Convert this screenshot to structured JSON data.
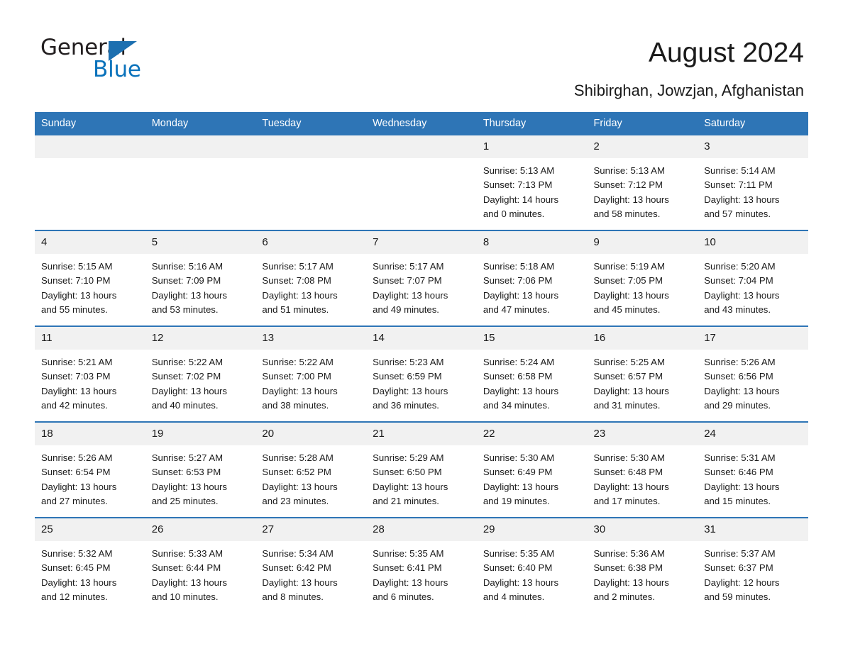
{
  "brand": {
    "word_one": "General",
    "word_two": "Blue",
    "triangle_color": "#1c6fb0",
    "blue_color": "#0a72bb",
    "logo_name": "general-blue-logo"
  },
  "header": {
    "title": "August 2024",
    "subtitle": "Shibirghan, Jowzjan, Afghanistan"
  },
  "theme": {
    "header_blue": "#2e75b6",
    "daynum_gray": "#f1f1f1",
    "text": "#1a1a1a"
  },
  "labels": {
    "sunrise_prefix": "Sunrise:",
    "sunset_prefix": "Sunset:",
    "daylight_prefix": "Daylight:"
  },
  "columns": [
    "Sunday",
    "Monday",
    "Tuesday",
    "Wednesday",
    "Thursday",
    "Friday",
    "Saturday"
  ],
  "weeks": [
    [
      {
        "day": "",
        "empty": true
      },
      {
        "day": "",
        "empty": true
      },
      {
        "day": "",
        "empty": true
      },
      {
        "day": "",
        "empty": true
      },
      {
        "day": "1",
        "sunrise": "Sunrise: 5:13 AM",
        "sunset": "Sunset: 7:13 PM",
        "daylight_1": "Daylight: 14 hours",
        "daylight_2": "and 0 minutes."
      },
      {
        "day": "2",
        "sunrise": "Sunrise: 5:13 AM",
        "sunset": "Sunset: 7:12 PM",
        "daylight_1": "Daylight: 13 hours",
        "daylight_2": "and 58 minutes."
      },
      {
        "day": "3",
        "sunrise": "Sunrise: 5:14 AM",
        "sunset": "Sunset: 7:11 PM",
        "daylight_1": "Daylight: 13 hours",
        "daylight_2": "and 57 minutes."
      }
    ],
    [
      {
        "day": "4",
        "sunrise": "Sunrise: 5:15 AM",
        "sunset": "Sunset: 7:10 PM",
        "daylight_1": "Daylight: 13 hours",
        "daylight_2": "and 55 minutes."
      },
      {
        "day": "5",
        "sunrise": "Sunrise: 5:16 AM",
        "sunset": "Sunset: 7:09 PM",
        "daylight_1": "Daylight: 13 hours",
        "daylight_2": "and 53 minutes."
      },
      {
        "day": "6",
        "sunrise": "Sunrise: 5:17 AM",
        "sunset": "Sunset: 7:08 PM",
        "daylight_1": "Daylight: 13 hours",
        "daylight_2": "and 51 minutes."
      },
      {
        "day": "7",
        "sunrise": "Sunrise: 5:17 AM",
        "sunset": "Sunset: 7:07 PM",
        "daylight_1": "Daylight: 13 hours",
        "daylight_2": "and 49 minutes."
      },
      {
        "day": "8",
        "sunrise": "Sunrise: 5:18 AM",
        "sunset": "Sunset: 7:06 PM",
        "daylight_1": "Daylight: 13 hours",
        "daylight_2": "and 47 minutes."
      },
      {
        "day": "9",
        "sunrise": "Sunrise: 5:19 AM",
        "sunset": "Sunset: 7:05 PM",
        "daylight_1": "Daylight: 13 hours",
        "daylight_2": "and 45 minutes."
      },
      {
        "day": "10",
        "sunrise": "Sunrise: 5:20 AM",
        "sunset": "Sunset: 7:04 PM",
        "daylight_1": "Daylight: 13 hours",
        "daylight_2": "and 43 minutes."
      }
    ],
    [
      {
        "day": "11",
        "sunrise": "Sunrise: 5:21 AM",
        "sunset": "Sunset: 7:03 PM",
        "daylight_1": "Daylight: 13 hours",
        "daylight_2": "and 42 minutes."
      },
      {
        "day": "12",
        "sunrise": "Sunrise: 5:22 AM",
        "sunset": "Sunset: 7:02 PM",
        "daylight_1": "Daylight: 13 hours",
        "daylight_2": "and 40 minutes."
      },
      {
        "day": "13",
        "sunrise": "Sunrise: 5:22 AM",
        "sunset": "Sunset: 7:00 PM",
        "daylight_1": "Daylight: 13 hours",
        "daylight_2": "and 38 minutes."
      },
      {
        "day": "14",
        "sunrise": "Sunrise: 5:23 AM",
        "sunset": "Sunset: 6:59 PM",
        "daylight_1": "Daylight: 13 hours",
        "daylight_2": "and 36 minutes."
      },
      {
        "day": "15",
        "sunrise": "Sunrise: 5:24 AM",
        "sunset": "Sunset: 6:58 PM",
        "daylight_1": "Daylight: 13 hours",
        "daylight_2": "and 34 minutes."
      },
      {
        "day": "16",
        "sunrise": "Sunrise: 5:25 AM",
        "sunset": "Sunset: 6:57 PM",
        "daylight_1": "Daylight: 13 hours",
        "daylight_2": "and 31 minutes."
      },
      {
        "day": "17",
        "sunrise": "Sunrise: 5:26 AM",
        "sunset": "Sunset: 6:56 PM",
        "daylight_1": "Daylight: 13 hours",
        "daylight_2": "and 29 minutes."
      }
    ],
    [
      {
        "day": "18",
        "sunrise": "Sunrise: 5:26 AM",
        "sunset": "Sunset: 6:54 PM",
        "daylight_1": "Daylight: 13 hours",
        "daylight_2": "and 27 minutes."
      },
      {
        "day": "19",
        "sunrise": "Sunrise: 5:27 AM",
        "sunset": "Sunset: 6:53 PM",
        "daylight_1": "Daylight: 13 hours",
        "daylight_2": "and 25 minutes."
      },
      {
        "day": "20",
        "sunrise": "Sunrise: 5:28 AM",
        "sunset": "Sunset: 6:52 PM",
        "daylight_1": "Daylight: 13 hours",
        "daylight_2": "and 23 minutes."
      },
      {
        "day": "21",
        "sunrise": "Sunrise: 5:29 AM",
        "sunset": "Sunset: 6:50 PM",
        "daylight_1": "Daylight: 13 hours",
        "daylight_2": "and 21 minutes."
      },
      {
        "day": "22",
        "sunrise": "Sunrise: 5:30 AM",
        "sunset": "Sunset: 6:49 PM",
        "daylight_1": "Daylight: 13 hours",
        "daylight_2": "and 19 minutes."
      },
      {
        "day": "23",
        "sunrise": "Sunrise: 5:30 AM",
        "sunset": "Sunset: 6:48 PM",
        "daylight_1": "Daylight: 13 hours",
        "daylight_2": "and 17 minutes."
      },
      {
        "day": "24",
        "sunrise": "Sunrise: 5:31 AM",
        "sunset": "Sunset: 6:46 PM",
        "daylight_1": "Daylight: 13 hours",
        "daylight_2": "and 15 minutes."
      }
    ],
    [
      {
        "day": "25",
        "sunrise": "Sunrise: 5:32 AM",
        "sunset": "Sunset: 6:45 PM",
        "daylight_1": "Daylight: 13 hours",
        "daylight_2": "and 12 minutes."
      },
      {
        "day": "26",
        "sunrise": "Sunrise: 5:33 AM",
        "sunset": "Sunset: 6:44 PM",
        "daylight_1": "Daylight: 13 hours",
        "daylight_2": "and 10 minutes."
      },
      {
        "day": "27",
        "sunrise": "Sunrise: 5:34 AM",
        "sunset": "Sunset: 6:42 PM",
        "daylight_1": "Daylight: 13 hours",
        "daylight_2": "and 8 minutes."
      },
      {
        "day": "28",
        "sunrise": "Sunrise: 5:35 AM",
        "sunset": "Sunset: 6:41 PM",
        "daylight_1": "Daylight: 13 hours",
        "daylight_2": "and 6 minutes."
      },
      {
        "day": "29",
        "sunrise": "Sunrise: 5:35 AM",
        "sunset": "Sunset: 6:40 PM",
        "daylight_1": "Daylight: 13 hours",
        "daylight_2": "and 4 minutes."
      },
      {
        "day": "30",
        "sunrise": "Sunrise: 5:36 AM",
        "sunset": "Sunset: 6:38 PM",
        "daylight_1": "Daylight: 13 hours",
        "daylight_2": "and 2 minutes."
      },
      {
        "day": "31",
        "sunrise": "Sunrise: 5:37 AM",
        "sunset": "Sunset: 6:37 PM",
        "daylight_1": "Daylight: 12 hours",
        "daylight_2": "and 59 minutes."
      }
    ]
  ]
}
